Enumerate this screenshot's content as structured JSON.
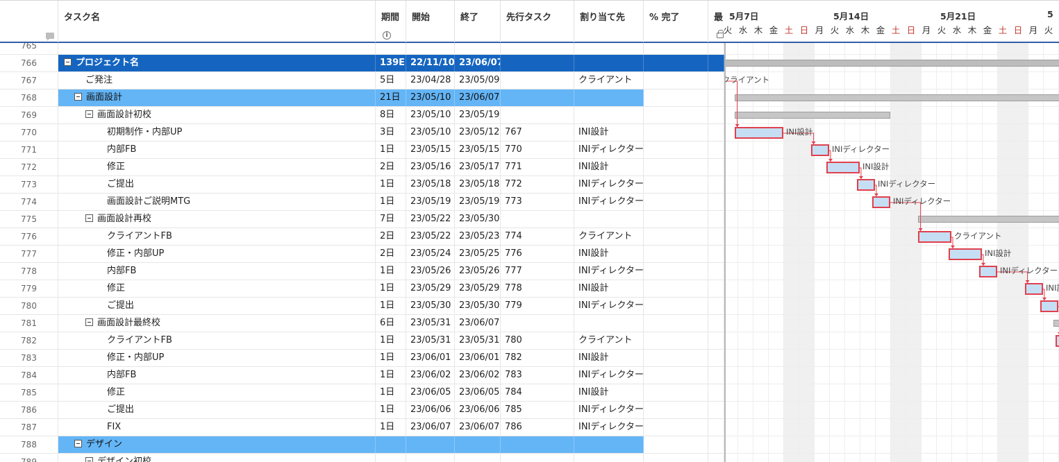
{
  "columns": {
    "task_name": "タスク名",
    "duration": "期間",
    "start": "開始",
    "end": "終了",
    "predecessor": "先行タスク",
    "assignee": "割り当て先",
    "percent": "% 完了",
    "last": "最"
  },
  "timeline": {
    "weeks": [
      "5月7日",
      "5月14日",
      "5月21日",
      "5"
    ],
    "days": [
      "火",
      "水",
      "木",
      "金",
      "土",
      "日",
      "月",
      "火",
      "水",
      "木",
      "金",
      "土",
      "日",
      "月",
      "火",
      "水",
      "木",
      "金",
      "土",
      "日",
      "月",
      "火"
    ]
  },
  "rows": [
    {
      "num": "765",
      "name": "",
      "dur": "",
      "start": "",
      "end": "",
      "pred": "",
      "asg": ""
    },
    {
      "num": "766",
      "name": "プロジェクト名",
      "dur": "139E",
      "start": "22/11/10",
      "end": "23/06/07",
      "pred": "",
      "asg": ""
    },
    {
      "num": "767",
      "name": "ご発注",
      "dur": "5日",
      "start": "23/04/28",
      "end": "23/05/09",
      "pred": "",
      "asg": "クライアント"
    },
    {
      "num": "768",
      "name": "画面設計",
      "dur": "21日",
      "start": "23/05/10",
      "end": "23/06/07",
      "pred": "",
      "asg": ""
    },
    {
      "num": "769",
      "name": "画面設計初校",
      "dur": "8日",
      "start": "23/05/10",
      "end": "23/05/19",
      "pred": "",
      "asg": ""
    },
    {
      "num": "770",
      "name": "初期制作・内部UP",
      "dur": "3日",
      "start": "23/05/10",
      "end": "23/05/12",
      "pred": "767",
      "asg": "INI設計"
    },
    {
      "num": "771",
      "name": "内部FB",
      "dur": "1日",
      "start": "23/05/15",
      "end": "23/05/15",
      "pred": "770",
      "asg": "INIディレクター"
    },
    {
      "num": "772",
      "name": "修正",
      "dur": "2日",
      "start": "23/05/16",
      "end": "23/05/17",
      "pred": "771",
      "asg": "INI設計"
    },
    {
      "num": "773",
      "name": "ご提出",
      "dur": "1日",
      "start": "23/05/18",
      "end": "23/05/18",
      "pred": "772",
      "asg": "INIディレクター"
    },
    {
      "num": "774",
      "name": "画面設計ご説明MTG",
      "dur": "1日",
      "start": "23/05/19",
      "end": "23/05/19",
      "pred": "773",
      "asg": "INIディレクター"
    },
    {
      "num": "775",
      "name": "画面設計再校",
      "dur": "7日",
      "start": "23/05/22",
      "end": "23/05/30",
      "pred": "",
      "asg": ""
    },
    {
      "num": "776",
      "name": "クライアントFB",
      "dur": "2日",
      "start": "23/05/22",
      "end": "23/05/23",
      "pred": "774",
      "asg": "クライアント"
    },
    {
      "num": "777",
      "name": "修正・内部UP",
      "dur": "2日",
      "start": "23/05/24",
      "end": "23/05/25",
      "pred": "776",
      "asg": "INI設計"
    },
    {
      "num": "778",
      "name": "内部FB",
      "dur": "1日",
      "start": "23/05/26",
      "end": "23/05/26",
      "pred": "777",
      "asg": "INIディレクター"
    },
    {
      "num": "779",
      "name": "修正",
      "dur": "1日",
      "start": "23/05/29",
      "end": "23/05/29",
      "pred": "778",
      "asg": "INI設計"
    },
    {
      "num": "780",
      "name": "ご提出",
      "dur": "1日",
      "start": "23/05/30",
      "end": "23/05/30",
      "pred": "779",
      "asg": "INIディレクター"
    },
    {
      "num": "781",
      "name": "画面設計最終校",
      "dur": "6日",
      "start": "23/05/31",
      "end": "23/06/07",
      "pred": "",
      "asg": ""
    },
    {
      "num": "782",
      "name": "クライアントFB",
      "dur": "1日",
      "start": "23/05/31",
      "end": "23/05/31",
      "pred": "780",
      "asg": "クライアント"
    },
    {
      "num": "783",
      "name": "修正・内部UP",
      "dur": "1日",
      "start": "23/06/01",
      "end": "23/06/01",
      "pred": "782",
      "asg": "INI設計"
    },
    {
      "num": "784",
      "name": "内部FB",
      "dur": "1日",
      "start": "23/06/02",
      "end": "23/06/02",
      "pred": "783",
      "asg": "INIディレクター"
    },
    {
      "num": "785",
      "name": "修正",
      "dur": "1日",
      "start": "23/06/05",
      "end": "23/06/05",
      "pred": "784",
      "asg": "INI設計"
    },
    {
      "num": "786",
      "name": "ご提出",
      "dur": "1日",
      "start": "23/06/06",
      "end": "23/06/06",
      "pred": "785",
      "asg": "INIディレクター"
    },
    {
      "num": "787",
      "name": "FIX",
      "dur": "1日",
      "start": "23/06/07",
      "end": "23/06/07",
      "pred": "786",
      "asg": "INIディレクター"
    },
    {
      "num": "788",
      "name": "デザイン",
      "dur": "",
      "start": "",
      "end": "",
      "pred": "",
      "asg": ""
    },
    {
      "num": "789",
      "name": "デザイン初校",
      "dur": "",
      "start": "",
      "end": "",
      "pred": "",
      "asg": ""
    }
  ],
  "gantt_labels": [
    "クライアント",
    "INI設計",
    "INIディレクター",
    "INI設計",
    "INIディレクター",
    "INIディレクター",
    "クライアント",
    "INI設計",
    "INIディレクター",
    "INI設"
  ],
  "colors": {
    "selected_dark": "#1565c0",
    "selected_light": "#64b5f6",
    "task_bar_fill": "#c6def3",
    "task_bar_border": "#e0404e",
    "weekend_text": "#c0392b",
    "header_border": "#2f5ea8"
  },
  "icons": [
    "comment-icon",
    "info-icon",
    "lock-icon",
    "collapse-toggle-icon"
  ]
}
